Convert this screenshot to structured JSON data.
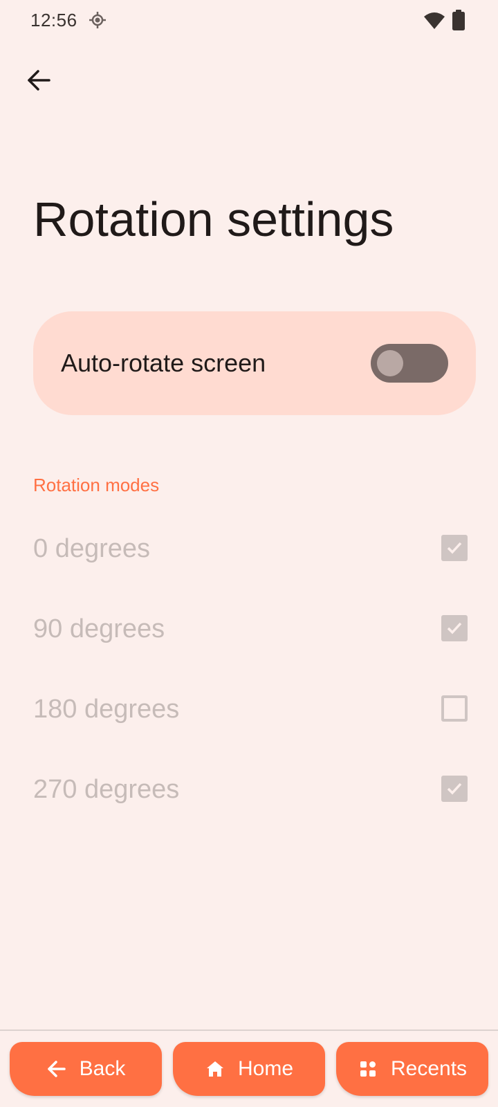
{
  "status_bar": {
    "time": "12:56",
    "location_icon": "location-crosshair-icon",
    "wifi_icon": "wifi-icon",
    "battery_icon": "battery-icon"
  },
  "header": {
    "back_icon": "arrow-left-icon",
    "title": "Rotation settings"
  },
  "auto_rotate": {
    "label": "Auto-rotate screen",
    "enabled": false
  },
  "rotation_modes": {
    "header": "Rotation modes",
    "items": [
      {
        "label": "0 degrees",
        "checked": true
      },
      {
        "label": "90 degrees",
        "checked": true
      },
      {
        "label": "180 degrees",
        "checked": false
      },
      {
        "label": "270 degrees",
        "checked": true
      }
    ]
  },
  "nav": {
    "back_label": "Back",
    "home_label": "Home",
    "recents_label": "Recents"
  },
  "colors": {
    "background": "#fcefec",
    "accent": "#ff7043",
    "card": "#ffdbd1",
    "disabled_text": "#c6bbb8"
  }
}
